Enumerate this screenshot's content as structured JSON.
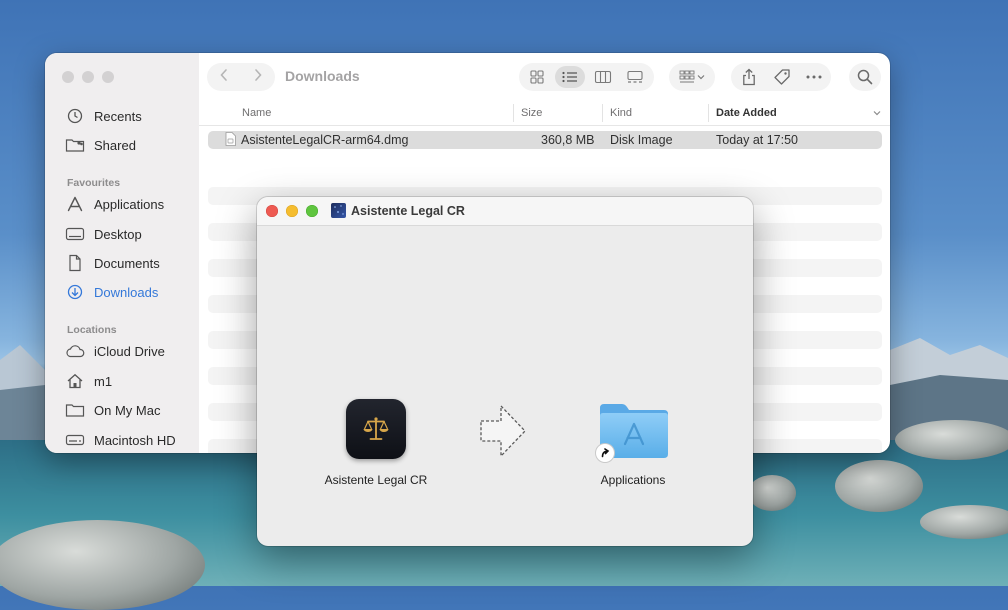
{
  "finder": {
    "title": "Downloads",
    "sidebar": {
      "items_top": [
        {
          "label": "Recents",
          "icon": "clock-icon"
        },
        {
          "label": "Shared",
          "icon": "shared-folder-icon"
        }
      ],
      "favourites_heading": "Favourites",
      "favourites": [
        {
          "label": "Applications",
          "icon": "applications-icon"
        },
        {
          "label": "Desktop",
          "icon": "desktop-icon"
        },
        {
          "label": "Documents",
          "icon": "document-icon"
        },
        {
          "label": "Downloads",
          "icon": "download-icon",
          "active": true
        }
      ],
      "locations_heading": "Locations",
      "locations": [
        {
          "label": "iCloud Drive",
          "icon": "cloud-icon"
        },
        {
          "label": "m1",
          "icon": "home-icon"
        },
        {
          "label": "On My Mac",
          "icon": "folder-icon"
        },
        {
          "label": "Macintosh HD",
          "icon": "disk-icon"
        }
      ]
    },
    "columns": {
      "name": "Name",
      "size": "Size",
      "kind": "Kind",
      "date_added": "Date Added"
    },
    "files": [
      {
        "name": "AsistenteLegalCR-arm64.dmg",
        "size": "360,8 MB",
        "kind": "Disk Image",
        "date_added": "Today at 17:50"
      }
    ]
  },
  "dmg_window": {
    "title": "Asistente Legal CR",
    "app_label": "Asistente Legal CR",
    "applications_label": "Applications"
  },
  "colors": {
    "accent": "#3478d9",
    "close": "#ee5a52",
    "minimize": "#f5bd2f",
    "zoom": "#5fc53f"
  }
}
